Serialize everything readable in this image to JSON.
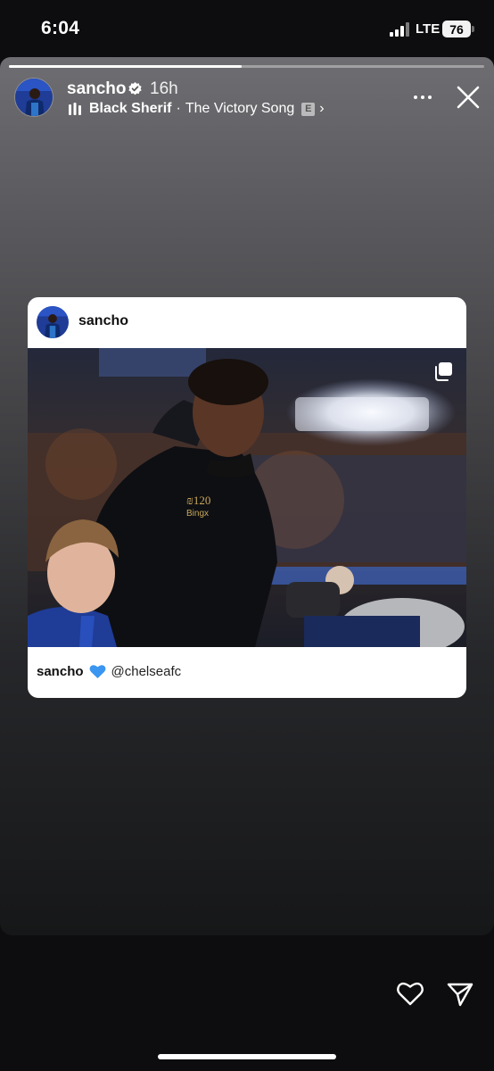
{
  "status_bar": {
    "time": "6:04",
    "network": "LTE",
    "battery": "76"
  },
  "story": {
    "progress": 0.49,
    "username": "sancho",
    "age": "16h",
    "music": {
      "artist": "Black Sherif",
      "song": "The Victory Song",
      "explicit_badge": "E"
    }
  },
  "post": {
    "username": "sancho",
    "caption_user": "sancho",
    "caption_emoji": "blue-heart-icon",
    "caption_mention": "@chelseafc"
  },
  "icons": {
    "verified": "verified-badge-icon",
    "more": "more-dots-icon",
    "close": "close-icon",
    "multi_photo": "multiple-photos-icon",
    "like": "heart-outline-icon",
    "share": "paper-plane-icon"
  },
  "colors": {
    "accent_blue": "#3a96f0",
    "chelsea_blue": "#1f3c96"
  }
}
